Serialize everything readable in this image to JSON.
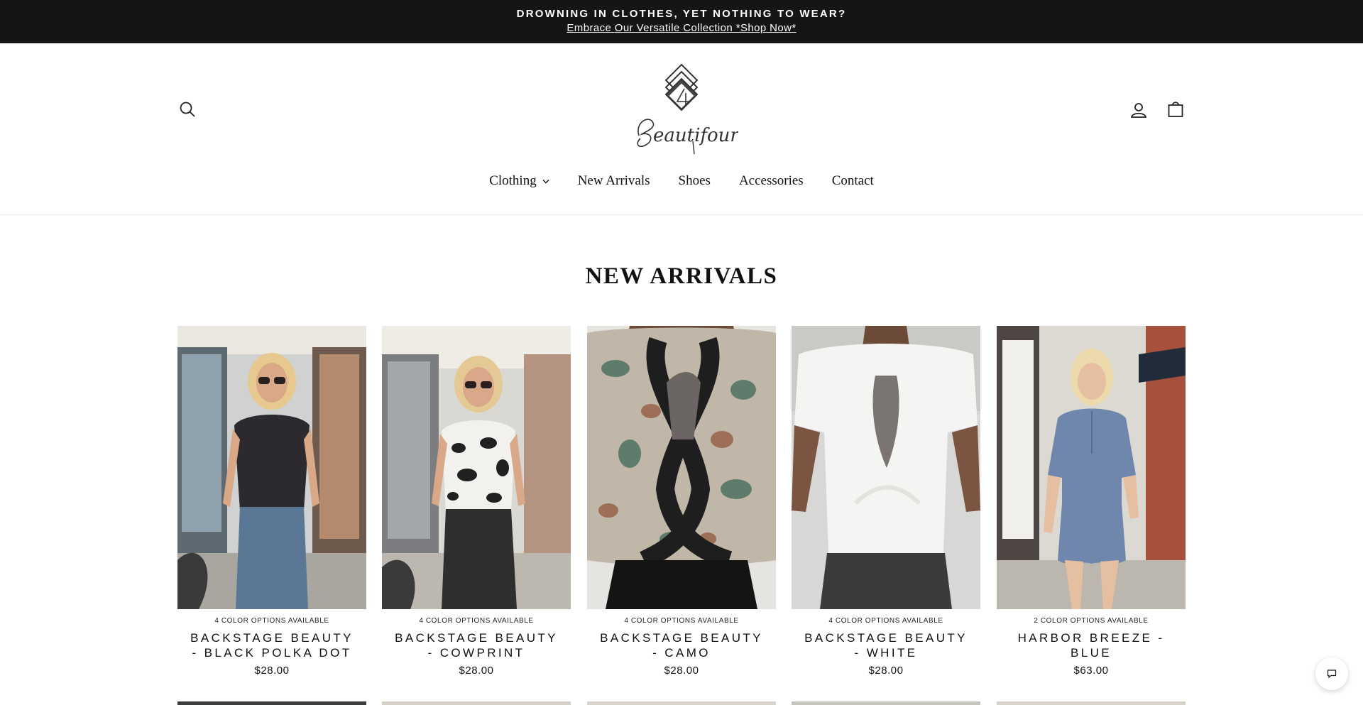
{
  "announcement": {
    "headline": "DROWNING IN CLOTHES, YET NOTHING TO WEAR?",
    "link_text": "Embrace Our Versatile Collection *Shop Now*"
  },
  "header": {
    "logo_text": "Beautifour",
    "icons": [
      "search-icon",
      "account-icon",
      "cart-icon"
    ]
  },
  "nav": {
    "items": [
      {
        "label": "Clothing",
        "has_dropdown": true
      },
      {
        "label": "New Arrivals",
        "has_dropdown": false
      },
      {
        "label": "Shoes",
        "has_dropdown": false
      },
      {
        "label": "Accessories",
        "has_dropdown": false
      },
      {
        "label": "Contact",
        "has_dropdown": false
      }
    ]
  },
  "section": {
    "title": "NEW ARRIVALS"
  },
  "products": [
    {
      "options": "4 COLOR OPTIONS AVAILABLE",
      "name": "BACKSTAGE BEAUTY - BLACK POLKA DOT",
      "price": "$28.00"
    },
    {
      "options": "4 COLOR OPTIONS AVAILABLE",
      "name": "BACKSTAGE BEAUTY - COWPRINT",
      "price": "$28.00"
    },
    {
      "options": "4 COLOR OPTIONS AVAILABLE",
      "name": "BACKSTAGE BEAUTY - CAMO",
      "price": "$28.00"
    },
    {
      "options": "4 COLOR OPTIONS AVAILABLE",
      "name": "BACKSTAGE BEAUTY - WHITE",
      "price": "$28.00"
    },
    {
      "options": "2 COLOR OPTIONS AVAILABLE",
      "name": "HARBOR BREEZE - BLUE",
      "price": "$63.00"
    }
  ],
  "colors": {
    "announcement_bg": "#151515",
    "text": "#111111"
  }
}
